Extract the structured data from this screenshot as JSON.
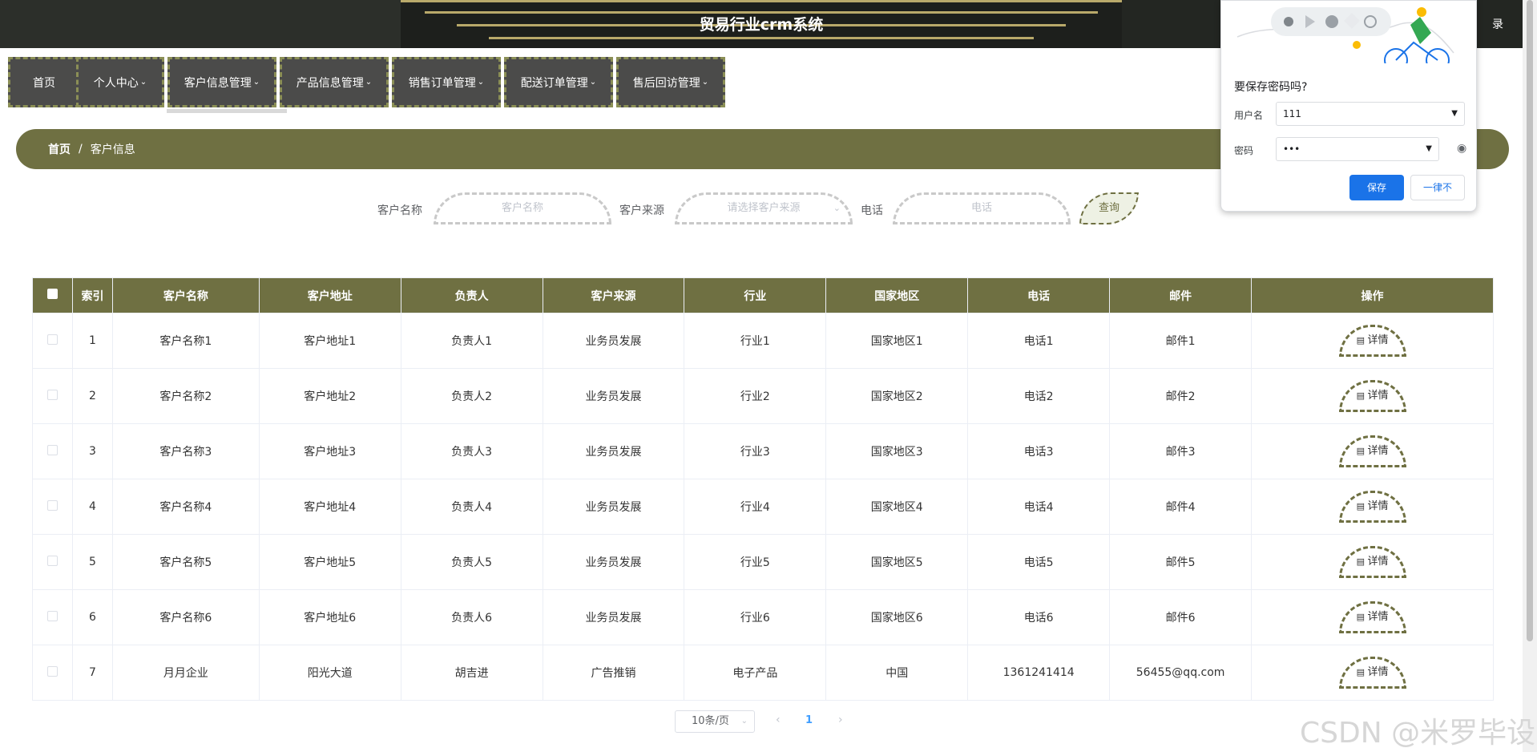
{
  "header": {
    "title": "贸易行业crm系统",
    "logout_partial": "录"
  },
  "nav": {
    "items": [
      {
        "label": "首页",
        "has_menu": false
      },
      {
        "label": "个人中心",
        "has_menu": true
      },
      {
        "label": "客户信息管理",
        "has_menu": true
      },
      {
        "label": "产品信息管理",
        "has_menu": true
      },
      {
        "label": "销售订单管理",
        "has_menu": true
      },
      {
        "label": "配送订单管理",
        "has_menu": true
      },
      {
        "label": "售后回访管理",
        "has_menu": true
      }
    ]
  },
  "breadcrumb": {
    "home": "首页",
    "sep": "/",
    "current": "客户信息"
  },
  "search": {
    "name_label": "客户名称",
    "name_placeholder": "客户名称",
    "source_label": "客户来源",
    "source_placeholder": "请选择客户来源",
    "phone_label": "电话",
    "phone_placeholder": "电话",
    "query_button": "查询"
  },
  "table": {
    "headers": [
      "索引",
      "客户名称",
      "客户地址",
      "负责人",
      "客户来源",
      "行业",
      "国家地区",
      "电话",
      "邮件",
      "操作"
    ],
    "detail_label": "详情",
    "rows": [
      {
        "index": "1",
        "name": "客户名称1",
        "address": "客户地址1",
        "owner": "负责人1",
        "source": "业务员发展",
        "industry": "行业1",
        "region": "国家地区1",
        "phone": "电话1",
        "email": "邮件1"
      },
      {
        "index": "2",
        "name": "客户名称2",
        "address": "客户地址2",
        "owner": "负责人2",
        "source": "业务员发展",
        "industry": "行业2",
        "region": "国家地区2",
        "phone": "电话2",
        "email": "邮件2"
      },
      {
        "index": "3",
        "name": "客户名称3",
        "address": "客户地址3",
        "owner": "负责人3",
        "source": "业务员发展",
        "industry": "行业3",
        "region": "国家地区3",
        "phone": "电话3",
        "email": "邮件3"
      },
      {
        "index": "4",
        "name": "客户名称4",
        "address": "客户地址4",
        "owner": "负责人4",
        "source": "业务员发展",
        "industry": "行业4",
        "region": "国家地区4",
        "phone": "电话4",
        "email": "邮件4"
      },
      {
        "index": "5",
        "name": "客户名称5",
        "address": "客户地址5",
        "owner": "负责人5",
        "source": "业务员发展",
        "industry": "行业5",
        "region": "国家地区5",
        "phone": "电话5",
        "email": "邮件5"
      },
      {
        "index": "6",
        "name": "客户名称6",
        "address": "客户地址6",
        "owner": "负责人6",
        "source": "业务员发展",
        "industry": "行业6",
        "region": "国家地区6",
        "phone": "电话6",
        "email": "邮件6"
      },
      {
        "index": "7",
        "name": "月月企业",
        "address": "阳光大道",
        "owner": "胡吉进",
        "source": "广告推销",
        "industry": "电子产品",
        "region": "中国",
        "phone": "1361241414",
        "email": "56455@qq.com"
      }
    ]
  },
  "pager": {
    "page_size": "10条/页",
    "current_page": "1"
  },
  "password_popup": {
    "question": "要保存密码吗?",
    "username_label": "用户名",
    "username_value": "111",
    "password_label": "密码",
    "password_value": "•••",
    "save_button": "保存",
    "never_button": "一律不"
  },
  "watermark": "CSDN @米罗毕设",
  "colors": {
    "accent": "#6f7042",
    "nav_bg": "#4b4b4a",
    "header_bg": "#232622",
    "chrome_blue": "#1a73e8"
  }
}
